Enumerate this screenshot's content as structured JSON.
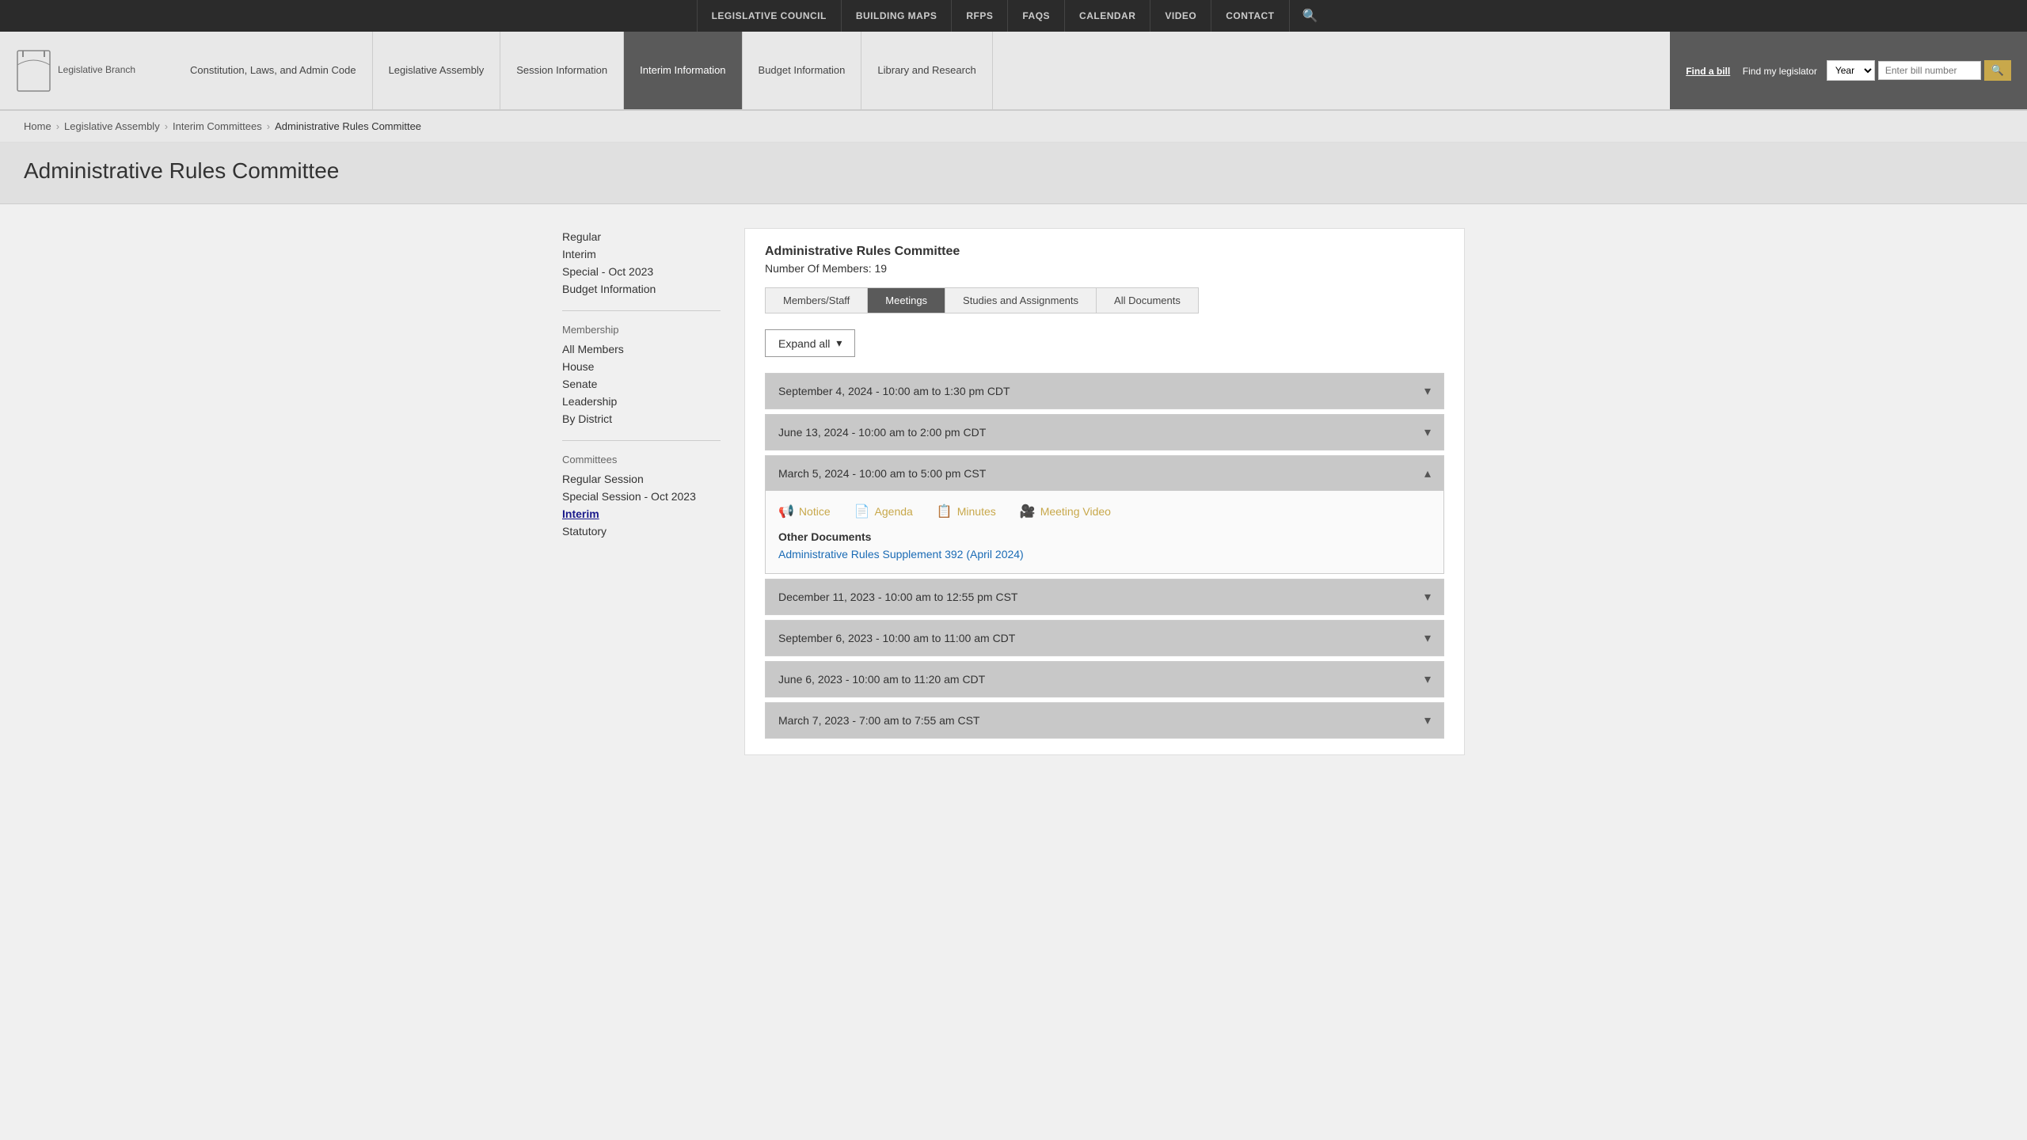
{
  "topNav": {
    "items": [
      {
        "label": "LEGISLATIVE COUNCIL",
        "id": "legislative-council"
      },
      {
        "label": "BUILDING MAPS",
        "id": "building-maps"
      },
      {
        "label": "RFPS",
        "id": "rfps"
      },
      {
        "label": "FAQS",
        "id": "faqs"
      },
      {
        "label": "CALENDAR",
        "id": "calendar"
      },
      {
        "label": "VIDEO",
        "id": "video"
      },
      {
        "label": "CONTACT",
        "id": "contact"
      }
    ]
  },
  "header": {
    "logoText": "Legislative Branch",
    "navItems": [
      {
        "label": "Constitution, Laws, and Admin Code",
        "id": "constitution",
        "active": false
      },
      {
        "label": "Legislative Assembly",
        "id": "legislative-assembly",
        "active": false
      },
      {
        "label": "Session Information",
        "id": "session-info",
        "active": false
      },
      {
        "label": "Interim Information",
        "id": "interim-info",
        "active": true
      },
      {
        "label": "Budget Information",
        "id": "budget-info",
        "active": false
      },
      {
        "label": "Library and Research",
        "id": "library-research",
        "active": false
      }
    ],
    "findBill": {
      "findBillLabel": "Find a bill",
      "findLegislatorLabel": "Find my legislator",
      "yearPlaceholder": "Year",
      "billInputPlaceholder": "Enter bill number"
    }
  },
  "breadcrumb": {
    "items": [
      {
        "label": "Home",
        "href": "#"
      },
      {
        "label": "Legislative Assembly",
        "href": "#"
      },
      {
        "label": "Interim Committees",
        "href": "#"
      },
      {
        "label": "Administrative Rules Committee",
        "current": true
      }
    ]
  },
  "pageTitle": "Administrative Rules Committee",
  "sidebar": {
    "topLinks": [
      {
        "label": "Regular",
        "id": "regular"
      },
      {
        "label": "Interim",
        "id": "interim"
      },
      {
        "label": "Special - Oct 2023",
        "id": "special-oct-2023"
      },
      {
        "label": "Budget Information",
        "id": "budget-information"
      }
    ],
    "membershipSection": {
      "label": "Membership",
      "links": [
        {
          "label": "All Members",
          "id": "all-members"
        },
        {
          "label": "House",
          "id": "house"
        },
        {
          "label": "Senate",
          "id": "senate"
        },
        {
          "label": "Leadership",
          "id": "leadership"
        },
        {
          "label": "By District",
          "id": "by-district"
        }
      ]
    },
    "committeesSection": {
      "label": "Committees",
      "links": [
        {
          "label": "Regular Session",
          "id": "regular-session"
        },
        {
          "label": "Special Session - Oct 2023",
          "id": "special-session-oct-2023"
        },
        {
          "label": "Interim",
          "id": "interim-committees",
          "active": true
        },
        {
          "label": "Statutory",
          "id": "statutory"
        }
      ]
    }
  },
  "mainPanel": {
    "committeeTitle": "Administrative Rules Committee",
    "memberCount": "Number Of Members: 19",
    "tabs": [
      {
        "label": "Members/Staff",
        "id": "members-staff",
        "active": false
      },
      {
        "label": "Meetings",
        "id": "meetings",
        "active": true
      },
      {
        "label": "Studies and Assignments",
        "id": "studies-assignments",
        "active": false
      },
      {
        "label": "All Documents",
        "id": "all-documents",
        "active": false
      }
    ],
    "expandAllLabel": "Expand all",
    "meetings": [
      {
        "id": "meeting-1",
        "label": "September 4, 2024 - 10:00 am to 1:30 pm CDT",
        "open": false
      },
      {
        "id": "meeting-2",
        "label": "June 13, 2024 - 10:00 am to 2:00 pm CDT",
        "open": false
      },
      {
        "id": "meeting-3",
        "label": "March 5, 2024 - 10:00 am to 5:00 pm CST",
        "open": true,
        "docs": [
          {
            "label": "Notice",
            "icon": "📢"
          },
          {
            "label": "Agenda",
            "icon": "📄"
          },
          {
            "label": "Minutes",
            "icon": "📋"
          },
          {
            "label": "Meeting Video",
            "icon": "🎥"
          }
        ],
        "otherDocsLabel": "Other Documents",
        "otherDocs": [
          {
            "label": "Administrative Rules Supplement 392 (April 2024)",
            "href": "#"
          }
        ]
      },
      {
        "id": "meeting-4",
        "label": "December 11, 2023 - 10:00 am to 12:55 pm CST",
        "open": false
      },
      {
        "id": "meeting-5",
        "label": "September 6, 2023 - 10:00 am to 11:00 am CDT",
        "open": false
      },
      {
        "id": "meeting-6",
        "label": "June 6, 2023 - 10:00 am to 11:20 am CDT",
        "open": false
      },
      {
        "id": "meeting-7",
        "label": "March 7, 2023 - 7:00 am to 7:55 am CST",
        "open": false
      }
    ]
  }
}
